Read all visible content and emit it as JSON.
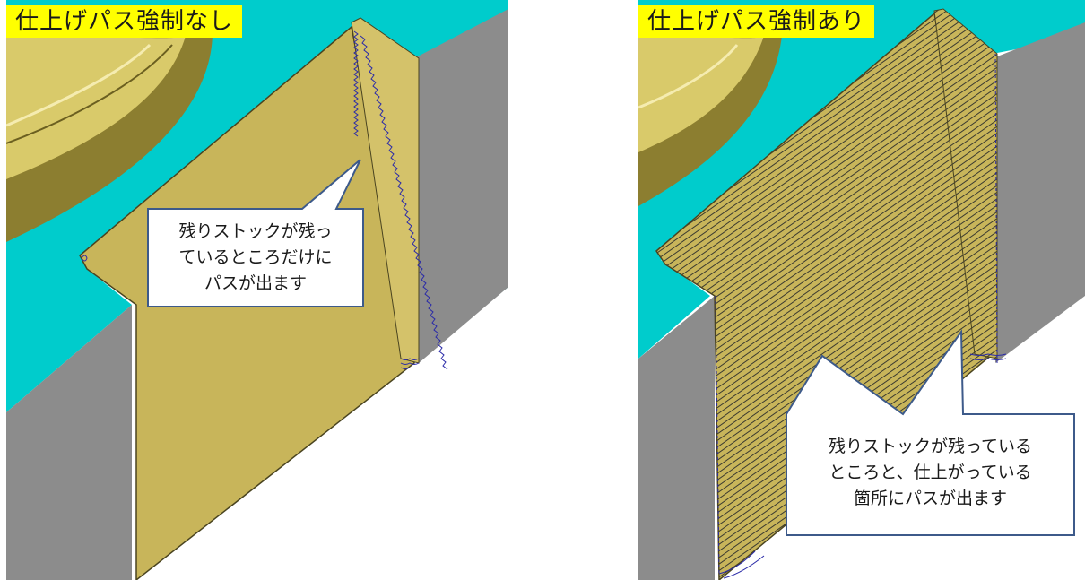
{
  "left_panel": {
    "title": "仕上げパス強制なし",
    "callout": {
      "lines": [
        "残りストックが残っ",
        "ているところだけに",
        "パスが出ます"
      ]
    }
  },
  "right_panel": {
    "title": "仕上げパス強制あり",
    "callout": {
      "lines": [
        "残りストックが残っている",
        "ところと、仕上がっている",
        "箇所にパスが出ます"
      ]
    }
  },
  "colors": {
    "label_bg": "#ffff00",
    "top_surface": "#00cccc",
    "part_face": "#c8b55a",
    "side_wall": "#8c8c8c",
    "callout_border": "#3d5a8a",
    "toolpath": "#2a2aa8"
  }
}
